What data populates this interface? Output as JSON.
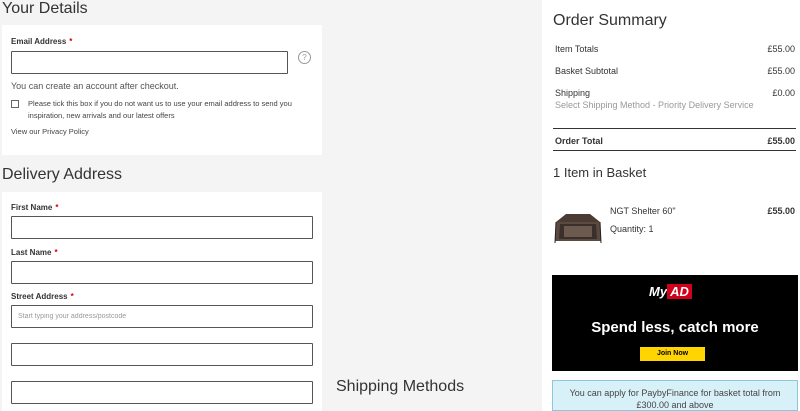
{
  "details": {
    "title": "Your Details",
    "email_label": "Email Address",
    "required_mark": "*",
    "help_icon": "?",
    "account_note": "You can create an account after checkout.",
    "optout_text": "Please tick this box if you do not want us to use your email address to send you inspiration, new arrivals and our latest offers",
    "privacy_link": "View our Privacy Policy"
  },
  "delivery": {
    "title": "Delivery Address",
    "first_name_label": "First Name",
    "last_name_label": "Last Name",
    "street_label": "Street Address",
    "street_placeholder": "Start typing your address/postcode"
  },
  "shipping_methods": {
    "title": "Shipping Methods"
  },
  "summary": {
    "title": "Order Summary",
    "item_totals_label": "Item Totals",
    "item_totals_value": "£55.00",
    "basket_subtotal_label": "Basket Subtotal",
    "basket_subtotal_value": "£55.00",
    "shipping_label": "Shipping",
    "shipping_value": "£0.00",
    "shipping_note": "Select Shipping Method - Priority Delivery Service",
    "order_total_label": "Order Total",
    "order_total_value": "£55.00"
  },
  "basket": {
    "title": "1 Item in Basket",
    "item_name": "NGT Shelter 60\"",
    "item_price": "£55.00",
    "item_qty": "Quantity: 1"
  },
  "promo": {
    "logo_my": "My",
    "logo_ad": "AD",
    "tagline": "Spend less, catch more",
    "button": "Join Now",
    "accent": "#d0021b",
    "button_color": "#ffd400"
  },
  "finance": {
    "text": "You can apply for PaybyFinance for basket total from £300.00 and above"
  }
}
